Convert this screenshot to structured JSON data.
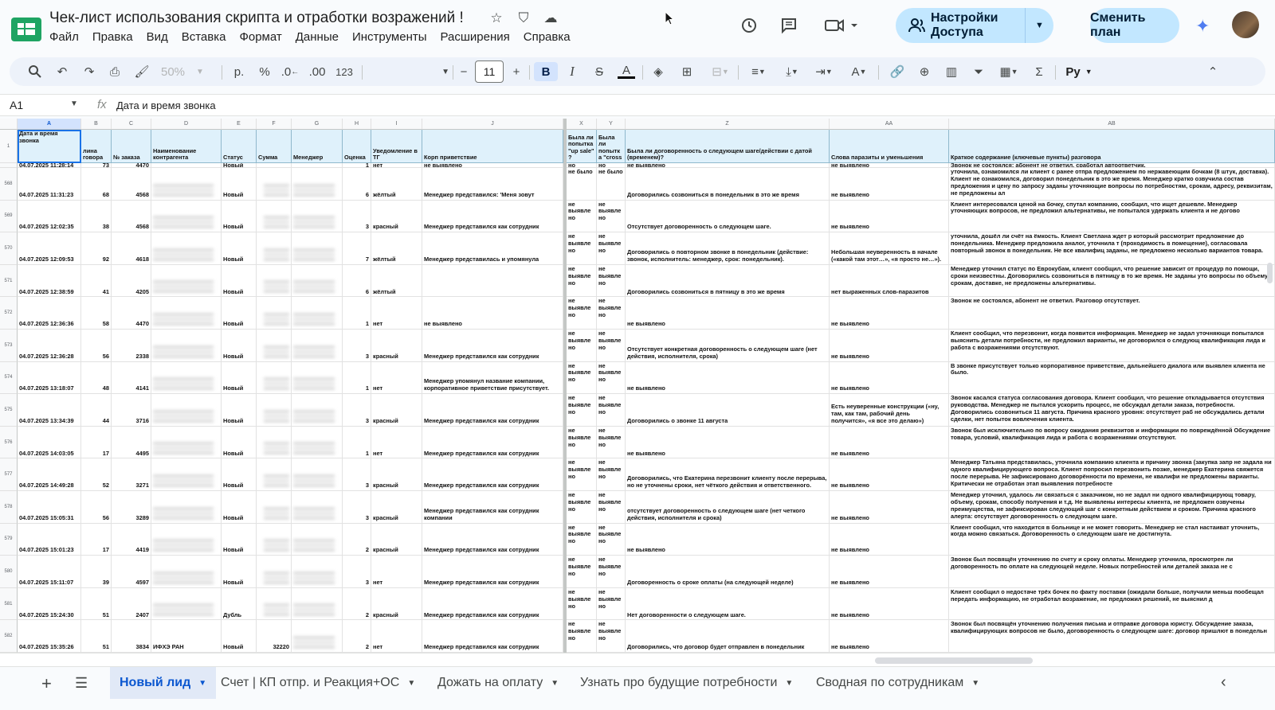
{
  "doc": {
    "title": "Чек-лист использования скрипта и отработки возражений !",
    "menu": [
      "Файл",
      "Правка",
      "Вид",
      "Вставка",
      "Формат",
      "Данные",
      "Инструменты",
      "Расширения",
      "Справка"
    ],
    "share_label": "Настройки Доступа",
    "plan_label": "Сменить план"
  },
  "toolbar": {
    "zoom": "50%",
    "currency": "р.",
    "percent": "%",
    "dec_less": ".0",
    "dec_more": ".00",
    "format_123": "123",
    "font_size": "11",
    "bold": "B",
    "italic": "I",
    "strike": "S",
    "text_color": "A",
    "lang": "Ру"
  },
  "formula": {
    "cell_ref": "A1",
    "fx": "fx",
    "value": "Дата и время звонка"
  },
  "columns": [
    "A",
    "B",
    "C",
    "D",
    "E",
    "F",
    "G",
    "H",
    "I",
    "J",
    "X",
    "Y",
    "Z",
    "AA",
    "AB"
  ],
  "headers": {
    "a": "Дата и время звонка",
    "b": "лина\nговора",
    "c": "№ заказа",
    "d": "Наименование контрагента",
    "e": "Статус",
    "f": "Сумма",
    "g": "Менеджер",
    "h": "Оценка",
    "i": "Уведомление в ТГ",
    "j": "Корп приветствие",
    "x": "Была ли попытка \"up sale\" ?",
    "y": "Была ли попытк а \"cross",
    "z": "Была ли договоренность о следующем шаге/действии с датой (временем)?",
    "aa": "Слова паразиты и уменьшения",
    "ab": "Краткое содержание (ключевые пункты) разговора"
  },
  "first_partial_row": {
    "a": "04.07.2025 11:28:14",
    "b": "73",
    "c": "4470",
    "e": "Новый",
    "h": "1",
    "i": "нет",
    "j": "не выявлено",
    "x": "но",
    "y": "но",
    "z": "не выявлено",
    "aa": "не выявлено",
    "ab": "Звонок не состоялся: абонент не ответил, сработал автоответчик."
  },
  "rows": [
    {
      "n": "568",
      "a": "04.07.2025 11:31:23",
      "b": "68",
      "c": "4568",
      "e": "Новый",
      "h": "6",
      "i": "жёлтый",
      "j": "Менеджер представился: 'Меня зовут",
      "x": "не было",
      "y": "не было",
      "z": "Договорились созвониться в понедельник в это же время",
      "aa": "не выявлено",
      "ab": "уточнила, ознакомился ли клиент с ранее отпра предложением по нержавеющим бочкам (8 штук, доставка). Клиент не ознакомился, договорил понедельник в это же время. Менеджер кратко озвучила состав предложения и цену по запросу заданы уточняющие вопросы по потребностям, срокам, адресу, реквизитам, не предложены ал"
    },
    {
      "n": "569",
      "a": "04.07.2025 12:02:35",
      "b": "38",
      "c": "4568",
      "e": "Новый",
      "h": "3",
      "i": "красный",
      "j": "Менеджер представился как сотрудник",
      "x": "не выявле но",
      "y": "не выявле но",
      "z": "Отсутствует договоренность о следующем шаге.",
      "aa": "не выявлено",
      "ab": "Клиент интересовался ценой на бочку, спутал компанию, сообщил, что ищет дешевле. Менеджер уточняющих вопросов, не предложил альтернативы, не попытался удержать клиента и не догово"
    },
    {
      "n": "570",
      "a": "04.07.2025 12:09:53",
      "b": "92",
      "c": "4618",
      "e": "Новый",
      "h": "7",
      "i": "жёлтый",
      "j": "Менеджер представилась и упомянула",
      "x": "не выявле но",
      "y": "не выявле но",
      "z": "Договорились о повторном звонке в понедельник (действие: звонок, исполнитель: менеджер, срок: понедельник).",
      "aa": "Небольшая неуверенность в начале («какой там этот…», «я просто не…»).",
      "ab": "уточнила, дошёл ли счёт на ёмкость. Клиент Светлана ждет р который рассмотрит предложение до понедельника. Менеджер предложила аналог, уточнила т (проходимость в помещение), согласовала повторный звонок в понедельник. Не все квалифиц заданы, не предложено несколько вариантов товара."
    },
    {
      "n": "571",
      "a": "04.07.2025 12:38:59",
      "b": "41",
      "c": "4205",
      "e": "Новый",
      "h": "6",
      "i": "жёлтый",
      "j": "",
      "x": "не выявле но",
      "y": "не выявле но",
      "z": "Договорились созвониться в пятницу в это же время",
      "aa": "нет выраженных слов-паразитов",
      "ab": "Менеджер уточнил статус по Еврокубам, клиент сообщил, что решение зависит от процедур по помощи, сроки неизвестны. Договорились созвониться в пятницу в то же время. Не заданы уто вопросы по объему, срокам, доставке, не предложены альтернативы."
    },
    {
      "n": "572",
      "a": "04.07.2025 12:36:36",
      "b": "58",
      "c": "4470",
      "e": "Новый",
      "h": "1",
      "i": "нет",
      "j": "не выявлено",
      "x": "не выявле но",
      "y": "не выявле но",
      "z": "не выявлено",
      "aa": "не выявлено",
      "ab": "Звонок не состоялся, абонент не ответил. Разговор отсутствует."
    },
    {
      "n": "573",
      "a": "04.07.2025 12:36:28",
      "b": "56",
      "c": "2338",
      "e": "Новый",
      "h": "3",
      "i": "красный",
      "j": "Менеджер представился как сотрудник",
      "x": "не выявле но",
      "y": "не выявле но",
      "z": "Отсутствует конкретная договоренность о следующем шаге (нет действия, исполнителя, срока)",
      "aa": "не выявлено",
      "ab": "Клиент сообщил, что перезвонит, когда появится информация. Менеджер не задал уточняющи попытался выяснить детали потребности, не предложил варианты, не договорился о следующ квалификация лида и работа с возражениями отсутствуют."
    },
    {
      "n": "574",
      "a": "04.07.2025 13:18:07",
      "b": "48",
      "c": "4141",
      "e": "Новый",
      "h": "1",
      "i": "нет",
      "j": "Менеджер упомянул название компании, корпоративное приветствие присутствует.",
      "x": "не выявле но",
      "y": "не выявле но",
      "z": "не выявлено",
      "aa": "не выявлено",
      "ab": "В звонке присутствует только корпоративное приветствие, дальнейшего диалога или выявлен клиента не было."
    },
    {
      "n": "575",
      "a": "04.07.2025 13:34:39",
      "b": "44",
      "c": "3716",
      "e": "Новый",
      "h": "3",
      "i": "красный",
      "j": "Менеджер представился как сотрудник",
      "x": "не выявле но",
      "y": "не выявле но",
      "z": "Договорились о звонке 11 августа",
      "aa": "Есть неуверенные конструкции («ну, там, как там, рабочий день получится», «я все это делаю»)",
      "ab": "Звонок касался статуса согласования договора. Клиент сообщил, что решение откладывается отсутствия руководства. Менеджер не пытался ускорить процесс, не обсуждал детали заказа, потребности. Договорились созвониться 11 августа. Причина красного уровня: отсутствует раб не обсуждались детали сделки, нет попыток вовлечения клиента."
    },
    {
      "n": "576",
      "a": "04.07.2025 14:03:05",
      "b": "17",
      "c": "4495",
      "e": "Новый",
      "h": "1",
      "i": "нет",
      "j": "Менеджер представился как сотрудник",
      "x": "не выявле но",
      "y": "не выявле но",
      "z": "не выявлено",
      "aa": "не выявлено",
      "ab": "Звонок был исключительно по вопросу ожидания реквизитов и информации по повреждённой Обсуждение товара, условий, квалификация лида и работа с возражениями отсутствуют."
    },
    {
      "n": "577",
      "a": "04.07.2025 14:49:28",
      "b": "52",
      "c": "3271",
      "e": "Новый",
      "h": "3",
      "i": "красный",
      "j": "Менеджер представился как сотрудник",
      "x": "не выявле но",
      "y": "не выявле но",
      "z": "Договорились, что Екатерина перезвонит клиенту после перерыва, но не уточнены сроки, нет чёткого действия и ответственного.",
      "aa": "не выявлено",
      "ab": "Менеджер Татьяна представилась, уточнила компанию клиента и причину звонка (закупка запр не задала ни одного квалифицирующего вопроса. Клиент попросил перезвонить позже, менеджер Екатерина свяжется после перерыва. Не зафиксировано договорённости по времени, не квалифи не предложены варианты. Критически не отработан этап выявления потребносте"
    },
    {
      "n": "578",
      "a": "04.07.2025 15:05:31",
      "b": "56",
      "c": "3289",
      "e": "Новый",
      "h": "3",
      "i": "красный",
      "j": "Менеджер представился как сотрудник компании",
      "x": "не выявле но",
      "y": "не выявле но",
      "z": "отсутствует договоренность о следующем шаге (нет четкого действия, исполнителя и срока)",
      "aa": "не выявлено",
      "ab": "Менеджер уточнил, удалось ли связаться с заказчиком, но не задал ни одного квалифицирующ товару, объему, срокам, способу получения и т.д. Не выявлены интересы клиента, не предложен озвучены преимущества, не зафиксирован следующий шаг с конкретным действием и сроком. Причина красного алерта: отсутствует договоренность о следующем шаге."
    },
    {
      "n": "579",
      "a": "04.07.2025 15:01:23",
      "b": "17",
      "c": "4419",
      "e": "Новый",
      "h": "2",
      "i": "красный",
      "j": "Менеджер представился как сотрудник",
      "x": "не выявле но",
      "y": "не выявле но",
      "z": "не выявлено",
      "aa": "не выявлено",
      "ab": "Клиент сообщил, что находится в больнице и не может говорить. Менеджер не стал настаиват уточнить, когда можно связаться. Договоренность о следующем шаге не достигнута."
    },
    {
      "n": "580",
      "a": "04.07.2025 15:11:07",
      "b": "39",
      "c": "4597",
      "e": "Новый",
      "h": "3",
      "i": "нет",
      "j": "Менеджер представился как сотрудник",
      "x": "не выявле но",
      "y": "не выявле но",
      "z": "Договоренность о сроке оплаты (на следующей неделе)",
      "aa": "не выявлено",
      "ab": "Звонок был посвящён уточнению по счету и сроку оплаты. Менеджер уточнила, просмотрен ли договоренность по оплате на следующей неделе. Новых потребностей или деталей заказа не с"
    },
    {
      "n": "581",
      "a": "04.07.2025 15:24:30",
      "b": "51",
      "c": "2407",
      "e": "Дубль",
      "h": "2",
      "i": "красный",
      "j": "Менеджер представился как сотрудник",
      "x": "не выявле но",
      "y": "не выявле но",
      "z": "Нет договоренности о следующем шаге.",
      "aa": "не выявлено",
      "ab": "Клиент сообщил о недостаче трёх бочек по факту поставки (ожидали больше, получили меньш пообещал передать информацию, не отработал возражение, не предложил решений, не выяснил д"
    },
    {
      "n": "582",
      "a": "04.07.2025 15:35:26",
      "b": "51",
      "c": "3834",
      "e": "Новый",
      "h": "2",
      "i": "нет",
      "j": "Менеджер представился как сотрудник",
      "x": "не выявле но",
      "y": "не выявле но",
      "z": "Договорились, что договор будет отправлен в понедельник",
      "aa": "не выявлено",
      "ab": "Звонок был посвящён уточнению получения письма и отправке договора юристу. Обсуждение заказа, квалифицирующих вопросов не было, договоренность о следующем шаге: договор пришлют в понедельн"
    }
  ],
  "last_row_extra": {
    "d": "ИФХЭ РАН",
    "f": "32220"
  },
  "sheets": [
    {
      "label": "Новый лид",
      "active": true
    },
    {
      "label": "Счет | КП отпр. и Реакция+ОС",
      "active": false
    },
    {
      "label": "Дожать на оплату",
      "active": false
    },
    {
      "label": "Узнать про будущие потребности",
      "active": false
    },
    {
      "label": "Сводная по сотрудникам",
      "active": false
    }
  ],
  "colors": {
    "accent": "#0b57d0",
    "header_fill": "#dff1fb",
    "share_fill": "#c2e7ff"
  }
}
